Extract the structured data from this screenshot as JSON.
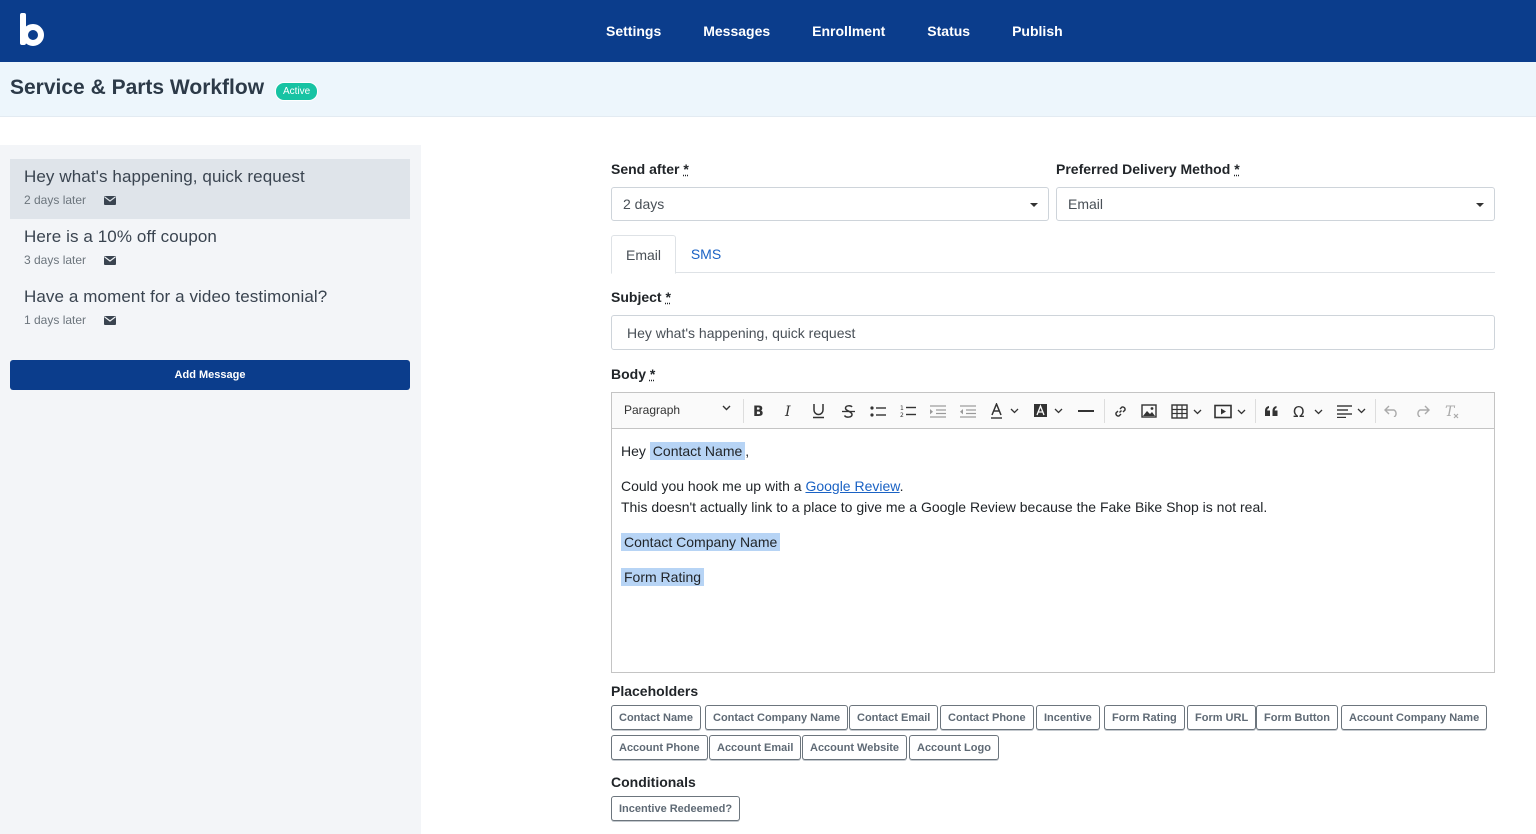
{
  "nav": {
    "items": [
      "Settings",
      "Messages",
      "Enrollment",
      "Status",
      "Publish"
    ]
  },
  "page": {
    "title": "Service & Parts Workflow",
    "status": "Active"
  },
  "sidebar": {
    "messages": [
      {
        "title": "Hey what's happening, quick request",
        "delay": "2 days later",
        "icon": "envelope-icon"
      },
      {
        "title": "Here is a 10% off coupon",
        "delay": "3 days later",
        "icon": "envelope-icon"
      },
      {
        "title": "Have a moment for a video testimonial?",
        "delay": "1 days later",
        "icon": "envelope-icon"
      }
    ],
    "add_label": "Add Message"
  },
  "form": {
    "send_after_label": "Send after",
    "send_after_value": "2 days",
    "delivery_label": "Preferred Delivery Method",
    "delivery_value": "Email",
    "required_mark": "*",
    "tabs": [
      "Email",
      "SMS"
    ],
    "subject_label": "Subject",
    "subject_value": "Hey what's happening, quick request",
    "body_label": "Body"
  },
  "editor": {
    "paragraph_style": "Paragraph",
    "greeting": "Hey",
    "placeholder_contact_name": "Contact Name",
    "comma": ",",
    "line1_prefix": "Could you hook me up with a ",
    "line1_link": "Google Review",
    "line1_suffix": ".",
    "line2": "This doesn't actually link to a place to give me a Google Review because the Fake Bike Shop is not real.",
    "placeholder_company": "Contact Company Name",
    "placeholder_rating": "Form Rating"
  },
  "placeholders": {
    "label": "Placeholders",
    "items": [
      "Contact Name",
      "Contact Company Name",
      "Contact Email",
      "Contact Phone",
      "Incentive",
      "Form Rating",
      "Form URL",
      "Form Button",
      "Account Company Name",
      "Account Phone",
      "Account Email",
      "Account Website",
      "Account Logo"
    ]
  },
  "conditionals": {
    "label": "Conditionals",
    "items": [
      "Incentive Redeemed?"
    ]
  }
}
